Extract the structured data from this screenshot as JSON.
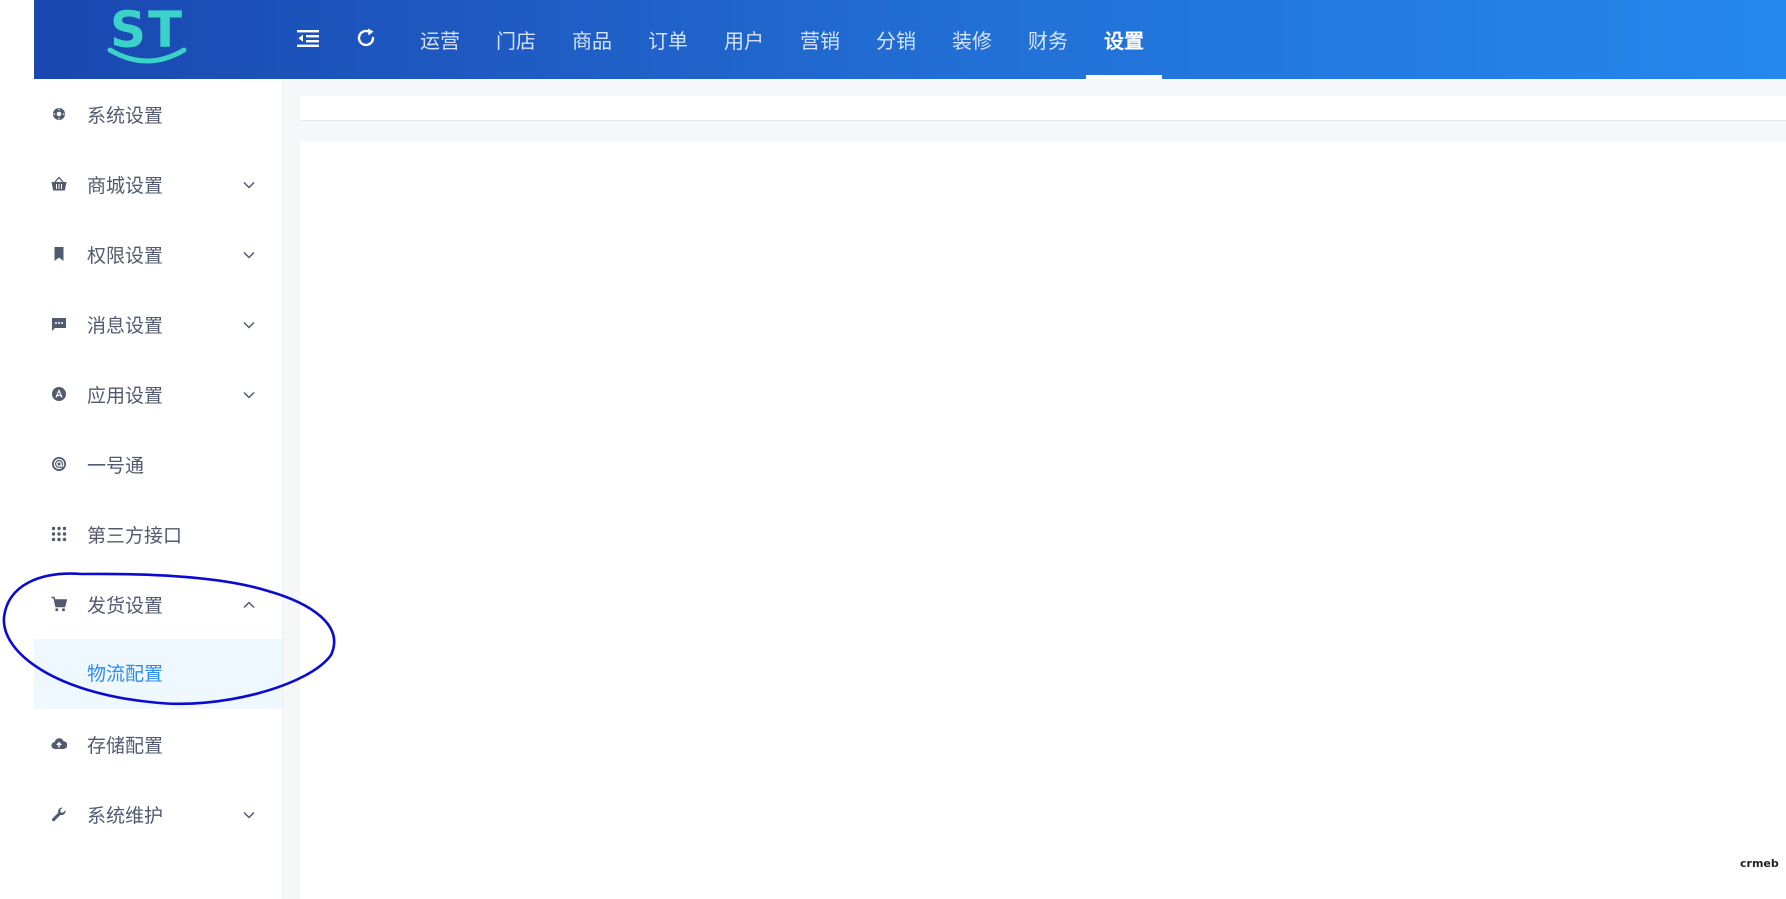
{
  "header": {
    "logo_text": "ST",
    "nav": [
      "运营",
      "门店",
      "商品",
      "订单",
      "用户",
      "营销",
      "分销",
      "装修",
      "财务",
      "设置"
    ],
    "active_nav": "设置"
  },
  "sidebar": {
    "items": [
      {
        "label": "系统设置",
        "icon": "gear-icon"
      },
      {
        "label": "商城设置",
        "icon": "basket-icon",
        "arrow": "down"
      },
      {
        "label": "权限设置",
        "icon": "bookmark-icon",
        "arrow": "down"
      },
      {
        "label": "消息设置",
        "icon": "message-icon",
        "arrow": "down"
      },
      {
        "label": "应用设置",
        "icon": "app-store-icon",
        "arrow": "down"
      },
      {
        "label": "一号通",
        "icon": "at-icon"
      },
      {
        "label": "第三方接口",
        "icon": "grid-dots-icon"
      },
      {
        "label": "发货设置",
        "icon": "cart-icon",
        "arrow": "up"
      },
      {
        "label": "存储配置",
        "icon": "cloud-upload-icon"
      },
      {
        "label": "系统维护",
        "icon": "wrench-icon",
        "arrow": "down"
      }
    ],
    "sub_item": {
      "label": "物流配置"
    }
  },
  "watermark": "crmeb",
  "colors": {
    "accent": "#2d8cf0",
    "annotation": "#0a0ad0",
    "logo": "#3bd3c9"
  }
}
